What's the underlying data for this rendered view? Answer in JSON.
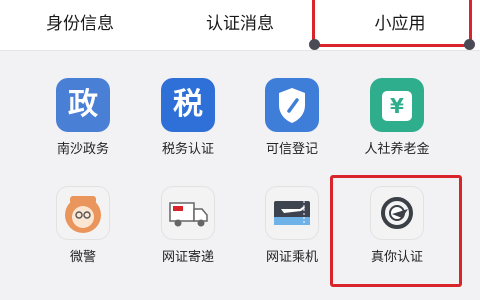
{
  "tabs": [
    "身份信息",
    "认证消息",
    "小应用"
  ],
  "apps": [
    {
      "label": "南沙政务",
      "glyph": "政",
      "color": "#4a7fd6"
    },
    {
      "label": "税务认证",
      "glyph": "税",
      "color": "#2e6fd8"
    },
    {
      "label": "可信登记",
      "glyph": "",
      "color": "#3f7ed8"
    },
    {
      "label": "人社养老金",
      "glyph": "¥",
      "color": "#2fae8e"
    },
    {
      "label": "微警",
      "glyph": "",
      "color": "#f3f3f3"
    },
    {
      "label": "网证寄递",
      "glyph": "",
      "color": "#f3f3f3"
    },
    {
      "label": "网证乘机",
      "glyph": "",
      "color": "#f3f3f3"
    },
    {
      "label": "真你认证",
      "glyph": "",
      "color": "#f3f3f3"
    }
  ],
  "colors": {
    "highlight": "#d8252b",
    "accent_blue": "#2e6fd8",
    "accent_green": "#2fae8e"
  }
}
